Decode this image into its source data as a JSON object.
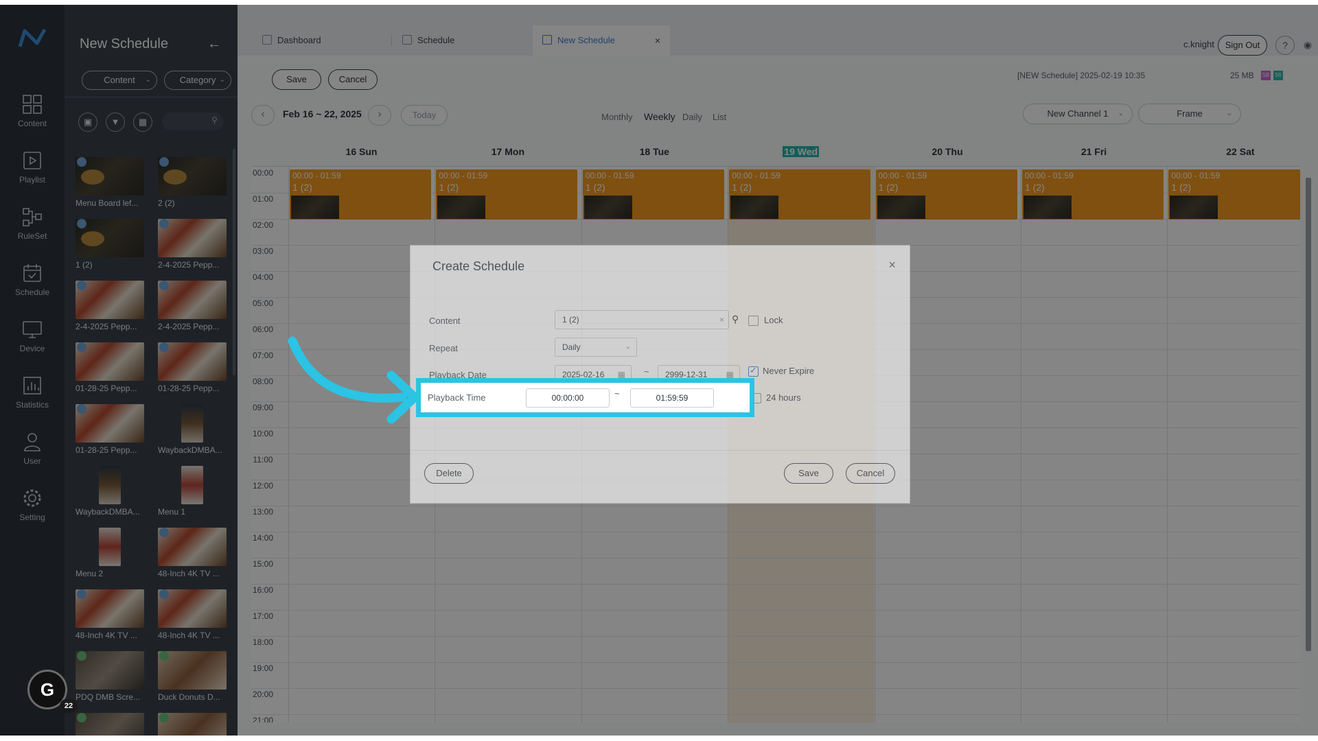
{
  "nav": {
    "items": [
      {
        "label": "Content",
        "icon": "content-grid-icon"
      },
      {
        "label": "Playlist",
        "icon": "playlist-icon"
      },
      {
        "label": "RuleSet",
        "icon": "ruleset-icon"
      },
      {
        "label": "Schedule",
        "icon": "schedule-calendar-icon"
      },
      {
        "label": "Device",
        "icon": "device-monitor-icon"
      },
      {
        "label": "Statistics",
        "icon": "statistics-chart-icon"
      },
      {
        "label": "User",
        "icon": "user-icon"
      },
      {
        "label": "Setting",
        "icon": "gear-icon"
      }
    ]
  },
  "panel": {
    "title": "New Schedule",
    "back": "←",
    "content_select": "Content",
    "category_select": "Category",
    "items": [
      {
        "label": "Menu Board lef...",
        "kind": "dark"
      },
      {
        "label": "2 (2)",
        "kind": "dark"
      },
      {
        "label": "1 (2)",
        "kind": "dark"
      },
      {
        "label": "2-4-2025 Pepp...",
        "kind": "food"
      },
      {
        "label": "2-4-2025 Pepp...",
        "kind": "food"
      },
      {
        "label": "2-4-2025 Pepp...",
        "kind": "food"
      },
      {
        "label": "01-28-25 Pepp...",
        "kind": "food"
      },
      {
        "label": "01-28-25 Pepp...",
        "kind": "food"
      },
      {
        "label": "01-28-25 Pepp...",
        "kind": "food"
      },
      {
        "label": "WaybackDMBA...",
        "kind": "portrait"
      },
      {
        "label": "WaybackDMBA...",
        "kind": "portrait"
      },
      {
        "label": "Menu 1",
        "kind": "portrait2"
      },
      {
        "label": "Menu 2",
        "kind": "portrait2"
      },
      {
        "label": "48-Inch 4K TV ...",
        "kind": "food"
      },
      {
        "label": "48-Inch 4K TV ...",
        "kind": "food"
      },
      {
        "label": "48-Inch 4K TV ...",
        "kind": "food"
      },
      {
        "label": "PDQ DMB Scre...",
        "kind": "video"
      },
      {
        "label": "Duck Donuts D...",
        "kind": "donut"
      },
      {
        "label": "",
        "kind": "video"
      },
      {
        "label": "",
        "kind": "donut"
      }
    ]
  },
  "tabs": [
    {
      "label": "Dashboard"
    },
    {
      "label": "Schedule"
    },
    {
      "label": "New Schedule",
      "close": "×"
    }
  ],
  "header": {
    "username": "c.knight",
    "sign_out": "Sign Out",
    "help": "?",
    "status": "[NEW Schedule] 2025-02-19 10:35",
    "size": "25 MB",
    "badge1": "SB",
    "badge2": "56"
  },
  "toolbar": {
    "save": "Save",
    "cancel": "Cancel"
  },
  "calendar": {
    "range": "Feb 16 ~ 22, 2025",
    "prev": "‹",
    "next": "›",
    "today": "Today",
    "views": [
      "Monthly",
      "Weekly",
      "Daily",
      "List"
    ],
    "channel": "New Channel 1",
    "frame": "Frame",
    "days": [
      "16 Sun",
      "17 Mon",
      "18 Tue",
      "19 Wed",
      "20 Thu",
      "21 Fri",
      "22 Sat"
    ],
    "hours": [
      "00:00",
      "01:00",
      "02:00",
      "03:00",
      "04:00",
      "05:00",
      "06:00",
      "07:00",
      "08:00",
      "09:00",
      "10:00",
      "11:00",
      "12:00",
      "13:00",
      "14:00",
      "15:00",
      "16:00",
      "17:00",
      "18:00",
      "19:00",
      "20:00",
      "21:00"
    ],
    "event": {
      "time": "00:00 - 01:59",
      "title": "1 (2)"
    }
  },
  "modal": {
    "title": "Create Schedule",
    "close": "×",
    "content_label": "Content",
    "content_value": "1 (2)",
    "content_clear": "×",
    "lock_label": "Lock",
    "repeat_label": "Repeat",
    "repeat_value": "Daily",
    "date_label": "Playback Date",
    "date_start": "2025-02-16",
    "date_end": "2999-12-31",
    "tilde": "~",
    "never_expire": "Never Expire",
    "time_label": "Playback Time",
    "time_start": "00:00:00",
    "time_end": "01:59:59",
    "hours24": "24 hours",
    "delete": "Delete",
    "save": "Save",
    "cancel": "Cancel"
  },
  "floating": {
    "letter": "G",
    "count": "22"
  },
  "colors": {
    "accent": "#3a7bd5",
    "event": "#f39a1f",
    "highlight": "#2bc4e4",
    "today": "#24b5a8"
  }
}
